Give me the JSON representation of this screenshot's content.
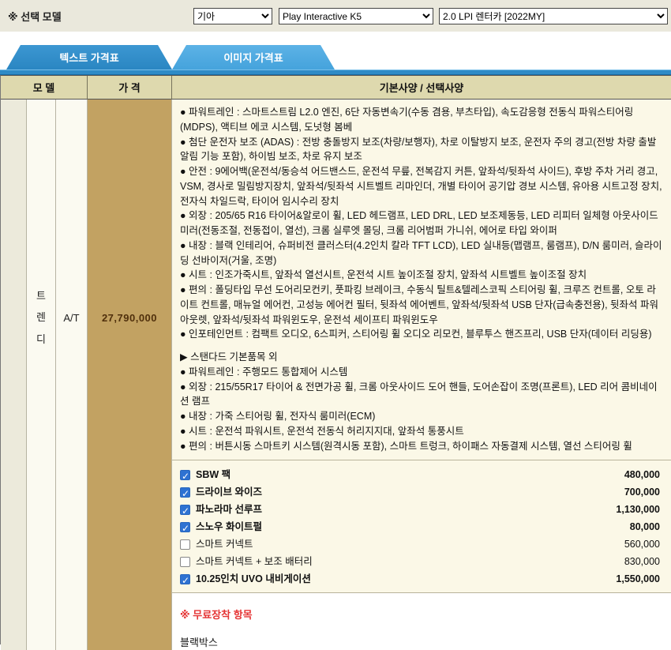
{
  "model_selector": {
    "label": "※ 선택 모델",
    "brand": "기아",
    "model": "Play Interactive K5",
    "trim": "2.0 LPI 렌터카 [2022MY]"
  },
  "tabs": {
    "text_tab": "텍스트 가격표",
    "image_tab": "이미지 가격표"
  },
  "table_headers": {
    "model": "모 델",
    "price": "가 격",
    "specs": "기본사양 / 선택사양"
  },
  "row": {
    "trim_name": "트렌디",
    "transmission": "A/T",
    "price": "27,790,000"
  },
  "specs_basic": [
    "● 파워트레인 : 스마트스트림 L2.0 엔진, 6단 자동변속기(수동 겸용, 부츠타입), 속도감응형 전동식 파워스티어링(MDPS), 액티브 에코 시스템, 도넛형 봄베",
    "● 첨단 운전자 보조 (ADAS) : 전방 충돌방지 보조(차량/보행자), 차로 이탈방지 보조, 운전자 주의 경고(전방 차량 출발 알림 기능 포함), 하이빔 보조, 차로 유지 보조",
    "● 안전 : 9에어백(운전석/동승석 어드밴스드, 운전석 무릎, 전복감지 커튼, 앞좌석/뒷좌석 사이드), 후방 주차 거리 경고, VSM, 경사로 밀림방지장치, 앞좌석/뒷좌석 시트벨트 리마인더, 개별 타이어 공기압 경보 시스템, 유아용 시트고정 장치, 전자식 차일드락, 타이어 임시수리 장치",
    "● 외장 : 205/65 R16 타이어&알로이 휠, LED 헤드램프, LED DRL, LED 보조제동등, LED 리피터 일체형 아웃사이드 미러(전동조절, 전동접이, 열선), 크롬 실루엣 몰딩, 크롬 리어범퍼 가니쉬, 에어로 타입 와이퍼",
    "● 내장 : 블랙 인테리어, 슈퍼비전 클러스터(4.2인치 칼라 TFT LCD), LED 실내등(맵램프, 룸램프), D/N 룸미러, 슬라이딩 선바이저(거울, 조명)",
    "● 시트 : 인조가죽시트, 앞좌석 열선시트, 운전석 시트 높이조절 장치, 앞좌석 시트벨트 높이조절 장치",
    "● 편의 : 폴딩타입 무선 도어리모컨키, 풋파킹 브레이크, 수동식 틸트&텔레스코픽 스티어링 휠, 크루즈 컨트롤, 오토 라이트 컨트롤, 매뉴얼 에어컨, 고성능 에어컨 필터, 뒷좌석 에어벤트, 앞좌석/뒷좌석 USB 단자(급속충전용), 뒷좌석 파워아웃렛, 앞좌석/뒷좌석 파워윈도우, 운전석 세이프티 파워윈도우",
    "● 인포테인먼트 : 컴팩트 오디오, 6스피커, 스티어링 휠 오디오 리모컨, 블루투스 핸즈프리, USB 단자(데이터 리딩용)"
  ],
  "specs_standard": [
    "▶ 스탠다드 기본품목 외",
    "● 파워트레인 : 주행모드 통합제어 시스템",
    "● 외장 : 215/55R17 타이어 & 전면가공 휠, 크롬 아웃사이드 도어 핸들, 도어손잡이 조명(프론트), LED 리어 콤비네이션 램프",
    "● 내장 : 가죽 스티어링 휠, 전자식 룸미러(ECM)",
    "● 시트 : 운전석 파워시트, 운전석 전동식 허리지지대, 앞좌석 통풍시트",
    "● 편의 : 버튼시동 스마트키 시스템(원격시동 포함), 스마트 트렁크, 하이패스 자동결제 시스템, 열선 스티어링 휠"
  ],
  "options": [
    {
      "label": "SBW 팩",
      "price": "480,000",
      "checked": true
    },
    {
      "label": "드라이브 와이즈",
      "price": "700,000",
      "checked": true
    },
    {
      "label": "파노라마 선루프",
      "price": "1,130,000",
      "checked": true
    },
    {
      "label": "스노우 화이트펄",
      "price": "80,000",
      "checked": true
    },
    {
      "label": "스마트 커넥트",
      "price": "560,000",
      "checked": false
    },
    {
      "label": "스마트 커넥트 + 보조 배터리",
      "price": "830,000",
      "checked": false
    },
    {
      "label": "10.25인치 UVO 내비게이션",
      "price": "1,550,000",
      "checked": true
    }
  ],
  "free_items": {
    "title": "※ 무료장착 항목",
    "items": [
      "블랙박스"
    ]
  },
  "colors": {
    "accent_blue": "#2e8bc6",
    "tab_inactive_blue": "#4aa9e0",
    "header_beige": "#ded9ae",
    "price_column_tan": "#c2a262",
    "content_cream": "#fbf8e7",
    "free_title_red": "#e53535",
    "checkbox_blue": "#2e72d2"
  }
}
